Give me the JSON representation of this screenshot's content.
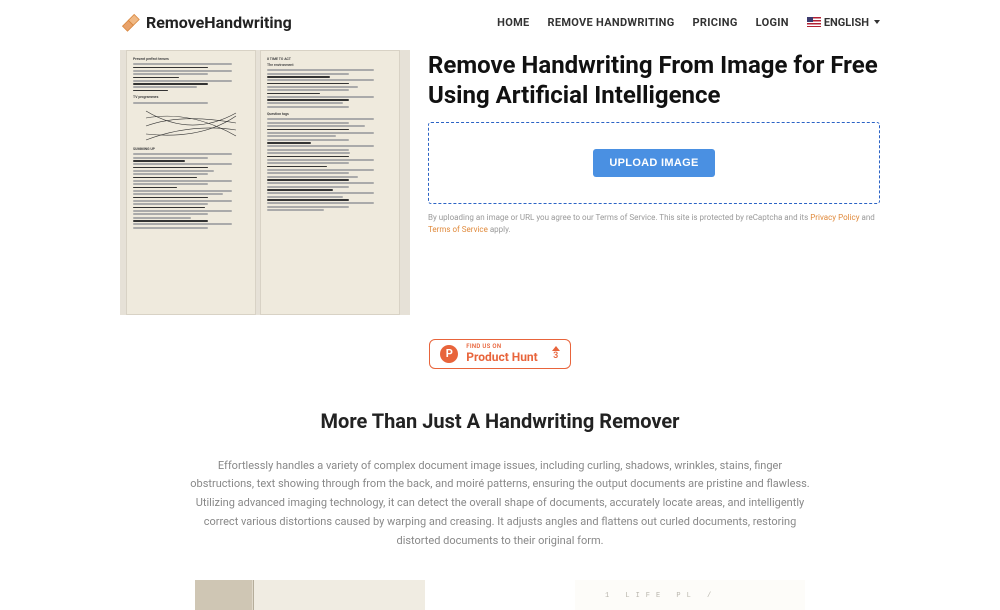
{
  "header": {
    "logo_text": "RemoveHandwriting",
    "nav": {
      "home": "HOME",
      "remove": "REMOVE HANDWRITING",
      "pricing": "PRICING",
      "login": "LOGIN",
      "language": "ENGLISH"
    }
  },
  "hero": {
    "title": "Remove Handwriting From Image for Free Using Artificial Intelligence",
    "upload_button": "UPLOAD IMAGE",
    "disclaimer_prefix": "By uploading an image or URL you agree to our Terms of Service. This site is protected by reCaptcha and its ",
    "privacy_link": "Privacy Policy",
    "disclaimer_and": " and ",
    "tos_link": "Terms of Service",
    "disclaimer_suffix": " apply."
  },
  "producthunt": {
    "top_label": "FIND US ON",
    "name": "Product Hunt",
    "count": "3"
  },
  "section": {
    "title": "More Than Just A Handwriting Remover",
    "description": "Effortlessly handles a variety of complex document image issues, including curling, shadows, wrinkles, stains, finger obstructions, text showing through from the back, and moiré patterns, ensuring the output documents are pristine and flawless. Utilizing advanced imaging technology, it can detect the overall shape of documents, accurately locate areas, and intelligently correct various distortions caused by warping and creasing. It adjusts angles and flattens out curled documents, restoring distorted documents to their original form."
  },
  "bottom_sample_text": "1 LIFE PL /"
}
